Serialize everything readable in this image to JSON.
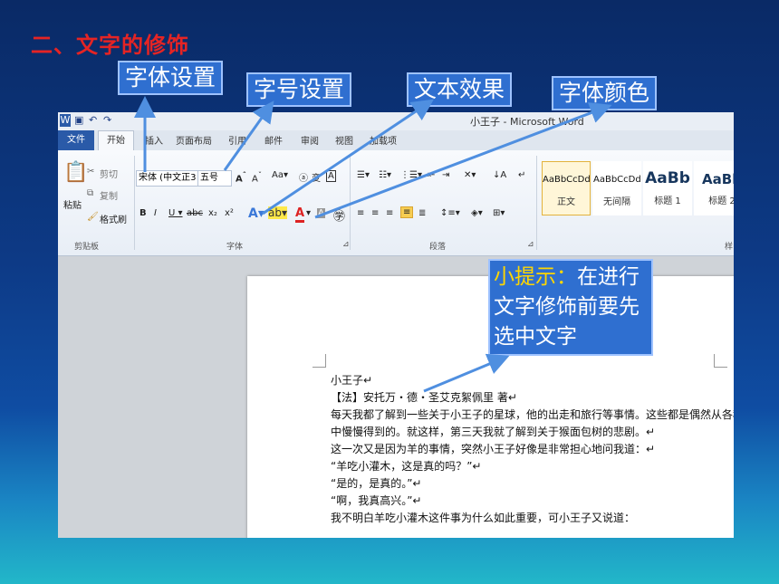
{
  "slide_title": "二、文字的修饰",
  "labels": {
    "font_setting": "字体设置",
    "size_setting": "字号设置",
    "text_effect": "文本效果",
    "font_color": "字体颜色"
  },
  "tip": {
    "prefix": "小提示：",
    "body": "在进行文字修饰前要先选中文字"
  },
  "word": {
    "window_title": "小王子 - Microsoft Word",
    "tabs": [
      "文件",
      "开始",
      "插入",
      "页面布局",
      "引用",
      "邮件",
      "审阅",
      "视图",
      "加载项"
    ],
    "clipboard": {
      "paste": "粘贴",
      "cut": "剪切",
      "copy": "复制",
      "format_painter": "格式刷",
      "group": "剪贴板"
    },
    "font": {
      "name": "宋体 (中文正3",
      "size": "五号",
      "group": "字体"
    },
    "paragraph": {
      "group": "段落"
    },
    "styles": [
      {
        "preview": "AaBbCcDd",
        "name": "正文"
      },
      {
        "preview": "AaBbCcDd",
        "name": "无间隔"
      },
      {
        "preview": "AaBb",
        "name": "标题 1"
      },
      {
        "preview": "AaBb",
        "name": "标题 2"
      }
    ],
    "styles_group": "样"
  },
  "document_lines": [
    "小王子↵",
    "【法】安托万・德・圣艾克絮佩里 著↵",
    "每天我都了解到一些关于小王子的星球，他的出走和旅行等事情。这些都是偶然从各种反应",
    "中慢慢得到的。就这样，第三天我就了解到关于猴面包树的悲剧。↵",
    "这一次又是因为羊的事情，突然小王子好像是非常担心地问我道：↵",
    "“羊吃小灌木，这是真的吗？”↵",
    "“是的，是真的。”↵",
    "“啊，我真高兴。”↵",
    "我不明白羊吃小灌木这件事为什么如此重要，可小王子又说道："
  ]
}
